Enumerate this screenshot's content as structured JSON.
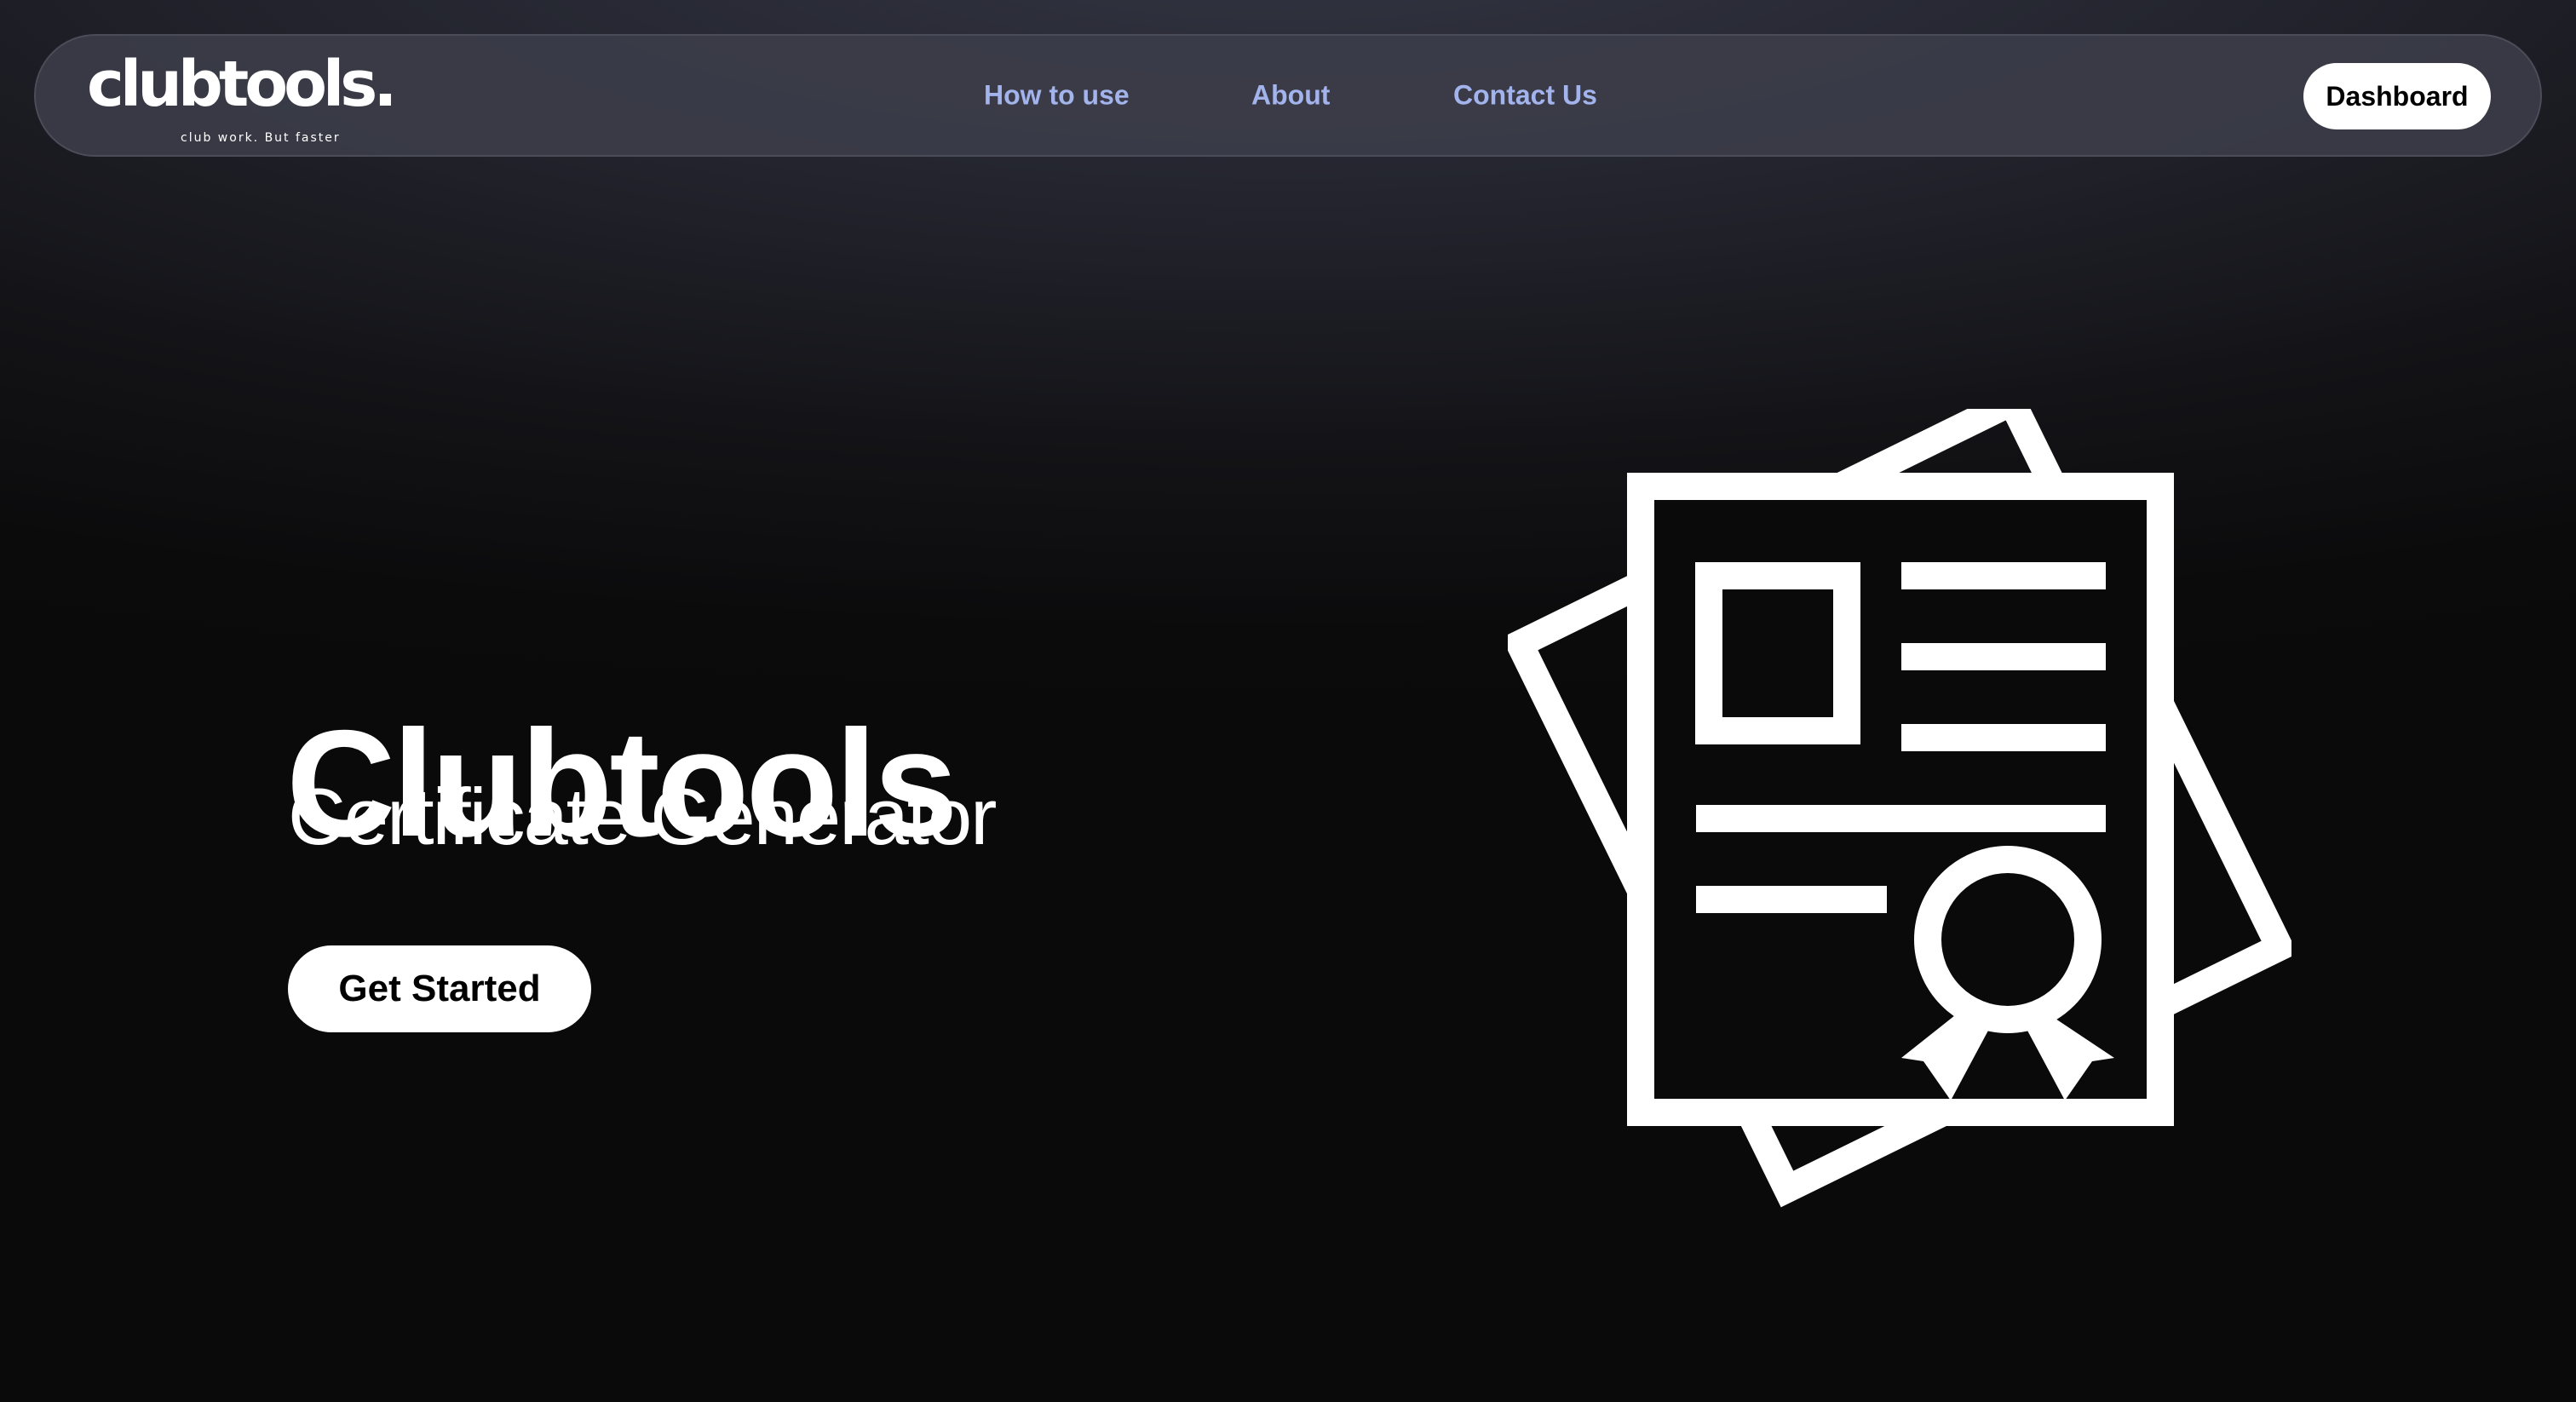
{
  "navbar": {
    "logo": {
      "wordmark": "clubtools.",
      "tagline": "club work. But faster"
    },
    "links": [
      {
        "label": "How to use"
      },
      {
        "label": "About"
      },
      {
        "label": "Contact Us"
      }
    ],
    "dashboard_label": "Dashboard"
  },
  "hero": {
    "title": "Clubtools",
    "subtitle": "Certificate Generator",
    "cta_label": "Get Started",
    "illustration_icon": "certificate-icon"
  },
  "colors": {
    "nav_link": "#a3b3ec",
    "button_bg": "#ffffff",
    "button_text": "#000000",
    "background": "#0a0a0a",
    "text": "#ffffff"
  }
}
